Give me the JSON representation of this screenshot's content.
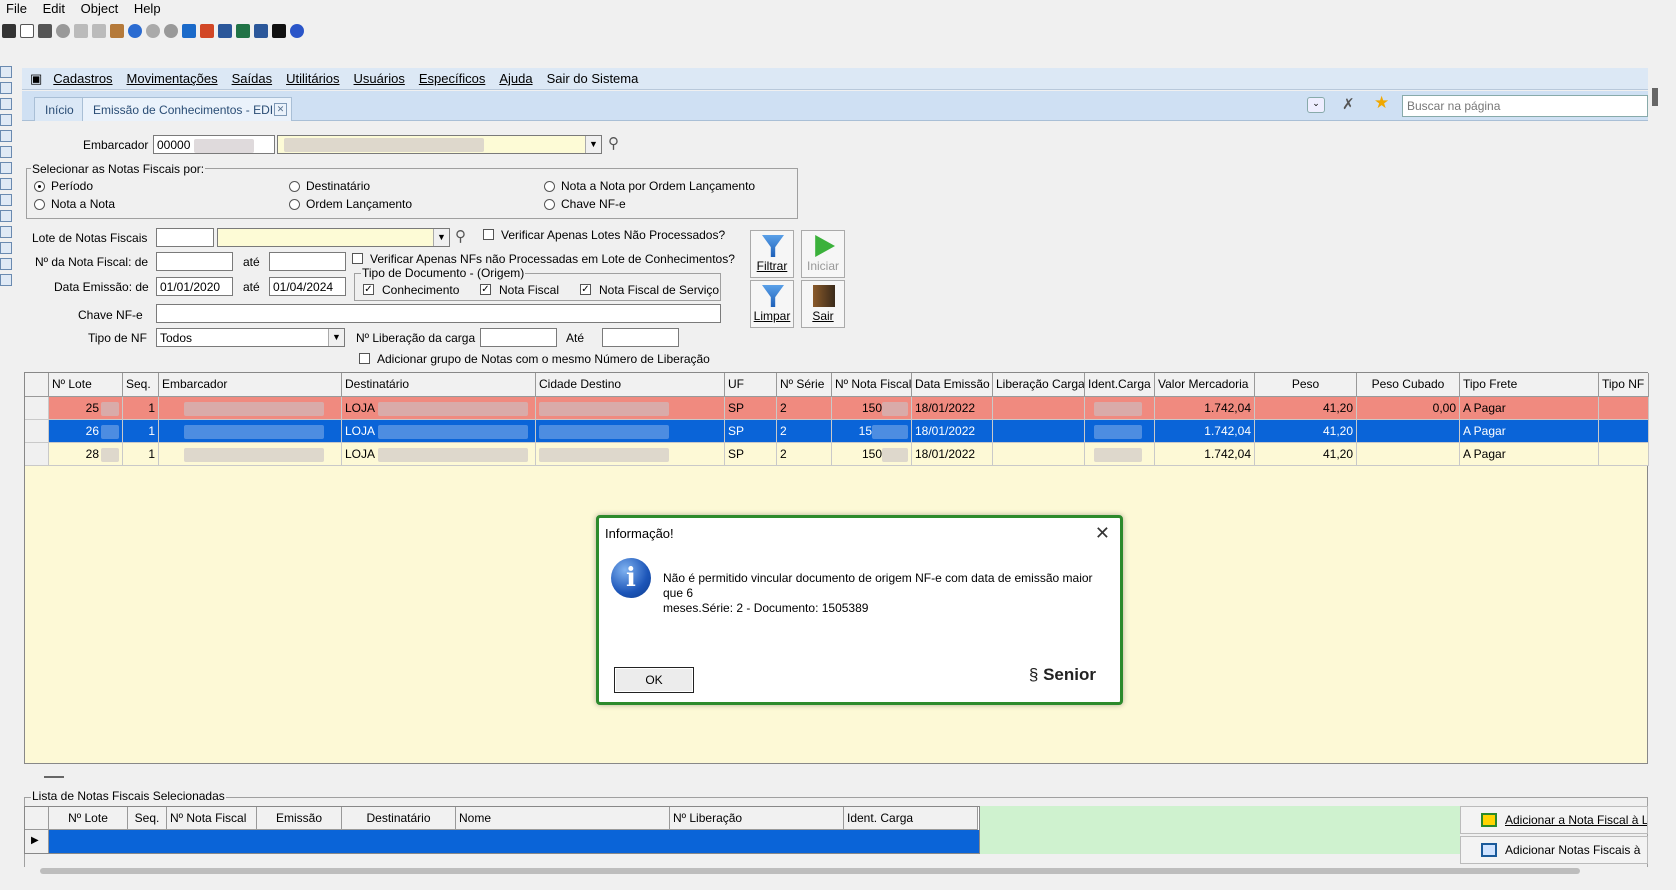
{
  "menubar": [
    "File",
    "Edit",
    "Object",
    "Help"
  ],
  "app_menu": [
    "Cadastros",
    "Movimentações",
    "Saídas",
    "Utilitários",
    "Usuários",
    "Específicos",
    "Ajuda",
    "Sair do Sistema"
  ],
  "tabs": {
    "home": "Início",
    "active": "Emissão de Conhecimentos - EDI"
  },
  "search": {
    "placeholder": "Buscar na página"
  },
  "form": {
    "embarcador_label": "Embarcador",
    "embarcador_code": "00000",
    "select_group_label": "Selecionar as Notas Fiscais por:",
    "options": [
      "Período",
      "Destinatário",
      "Nota a Nota por Ordem Lançamento",
      "Nota a Nota",
      "Ordem Lançamento",
      "Chave NF-e"
    ],
    "selected_option": "Período",
    "lote_label": "Lote de Notas Fiscais",
    "verificar_lotes_label": "Verificar Apenas Lotes Não Processados?",
    "nf_de_label": "Nº da Nota Fiscal: de",
    "ate_label": "até",
    "verificar_nfs_label": "Verificar Apenas NFs não Processadas em Lote de Conhecimentos?",
    "data_label": "Data Emissão: de",
    "data_de": "01/01/2020",
    "data_ate": "01/04/2024",
    "tipo_doc_label": "Tipo de Documento - (Origem)",
    "tipo_doc_opts": [
      "Conhecimento",
      "Nota Fiscal",
      "Nota Fiscal de Serviço"
    ],
    "chave_label": "Chave NF-e",
    "tipo_nf_label": "Tipo de NF",
    "tipo_nf_value": "Todos",
    "liberacao_label": "Nº Liberação da carga",
    "ate2_label": "Até",
    "adicionar_grupo_label": "Adicionar grupo de Notas com o mesmo Número de Liberação"
  },
  "buttons": {
    "filtrar": "Filtrar",
    "iniciar": "Iniciar",
    "limpar": "Limpar",
    "sair": "Sair"
  },
  "grid": {
    "headers": [
      "Nº Lote",
      "Seq.",
      "Embarcador",
      "Destinatário",
      "Cidade Destino",
      "UF",
      "Nº Série",
      "Nº Nota Fiscal",
      "Data Emissão",
      "Liberação Carga",
      "Ident.Carga",
      "Valor Mercadoria",
      "Peso",
      "Peso Cubado",
      "Tipo Frete",
      "Tipo NF"
    ],
    "rows": [
      {
        "lote": "25",
        "seq": "1",
        "dest": "LOJA",
        "uf": "SP",
        "serie": "2",
        "nf": "150",
        "data": "18/01/2022",
        "valor": "1.742,04",
        "peso": "41,20",
        "cubado": "0,00",
        "frete": "A Pagar"
      },
      {
        "lote": "26",
        "seq": "1",
        "dest": "LOJA",
        "uf": "SP",
        "serie": "2",
        "nf": "15",
        "data": "18/01/2022",
        "valor": "1.742,04",
        "peso": "41,20",
        "cubado": "",
        "frete": "A Pagar"
      },
      {
        "lote": "28",
        "seq": "1",
        "dest": "LOJA",
        "uf": "SP",
        "serie": "2",
        "nf": "150",
        "data": "18/01/2022",
        "valor": "1.742,04",
        "peso": "41,20",
        "cubado": "",
        "frete": "A Pagar"
      }
    ]
  },
  "dialog": {
    "title": "Informação!",
    "message_line1": "Não é permitido vincular documento de origem NF-e com data de emissão maior que 6",
    "message_line2": "meses.Série: 2 - Documento: 1505389",
    "ok": "OK",
    "logo": "Senior"
  },
  "selected_list": {
    "label": "Lista de Notas Fiscais Selecionadas",
    "headers": [
      "Nº Lote",
      "Seq.",
      "Nº Nota Fiscal",
      "Emissão",
      "Destinatário",
      "Nome",
      "Nº Liberação",
      "Ident. Carga"
    ],
    "add_one": "Adicionar a Nota Fiscal à L",
    "add_all": "Adicionar Notas Fiscais à"
  },
  "colors": {
    "row_red": "#f08a7f",
    "row_selected": "#0a64d8",
    "grid_bg": "#fdf9d6",
    "dialog_border": "#2c8a2c"
  }
}
